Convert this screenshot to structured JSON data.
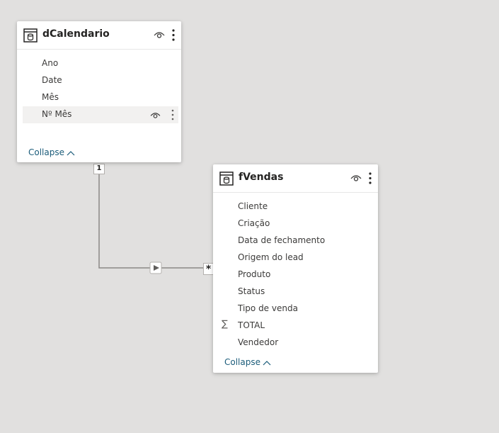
{
  "tables": [
    {
      "title": "dCalendario",
      "fields": [
        {
          "label": "Ano"
        },
        {
          "label": "Date"
        },
        {
          "label": "Mês"
        },
        {
          "label": "Nº Mês"
        }
      ],
      "collapse_label": "Collapse"
    },
    {
      "title": "fVendas",
      "fields": [
        {
          "label": "Cliente"
        },
        {
          "label": "Criação"
        },
        {
          "label": "Data de fechamento"
        },
        {
          "label": "Origem do lead"
        },
        {
          "label": "Produto"
        },
        {
          "label": "Status"
        },
        {
          "label": "Tipo de venda"
        },
        {
          "label": "TOTAL",
          "icon": "sigma-icon"
        },
        {
          "label": "Vendedor"
        }
      ],
      "collapse_label": "Collapse"
    }
  ],
  "relationship": {
    "one_side": "1",
    "many_side": "*",
    "direction_icon": "arrow-right-icon"
  },
  "colors": {
    "canvas": "#e1e0df",
    "link": "#1b5c7a",
    "line": "#8a8886"
  }
}
